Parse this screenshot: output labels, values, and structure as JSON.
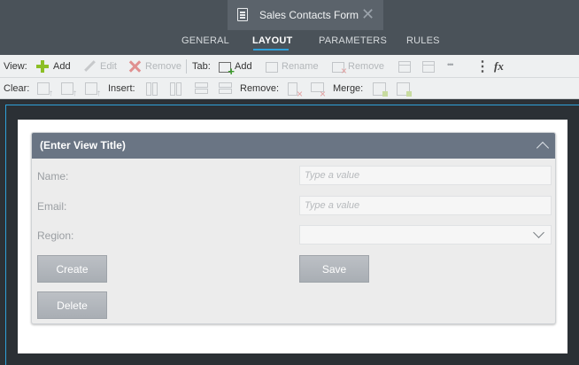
{
  "window": {
    "title": "Sales Contacts Form",
    "icon": "document-icon"
  },
  "nav": {
    "tabs": [
      {
        "label": "GENERAL",
        "active": false
      },
      {
        "label": "LAYOUT",
        "active": true
      },
      {
        "label": "PARAMETERS",
        "active": false
      },
      {
        "label": "RULES",
        "active": false
      }
    ],
    "accent_color": "#2fa1d9"
  },
  "toolbar": {
    "view_label": "View:",
    "view_add": "Add",
    "view_edit": "Edit",
    "view_remove": "Remove",
    "tab_label": "Tab:",
    "tab_add": "Add",
    "tab_rename": "Rename",
    "tab_remove": "Remove",
    "fx_label": "fx",
    "clear_label": "Clear:",
    "insert_label": "Insert:",
    "remove_label": "Remove:",
    "merge_label": "Merge:"
  },
  "view": {
    "title": "(Enter View Title)",
    "fields": [
      {
        "label": "Name:",
        "placeholder": "Type a value"
      },
      {
        "label": "Email:",
        "placeholder": "Type a value"
      },
      {
        "label": "Region:",
        "value": ""
      }
    ],
    "buttons": {
      "create": "Create",
      "save": "Save",
      "delete": "Delete"
    },
    "header_color": "#6a7584"
  }
}
